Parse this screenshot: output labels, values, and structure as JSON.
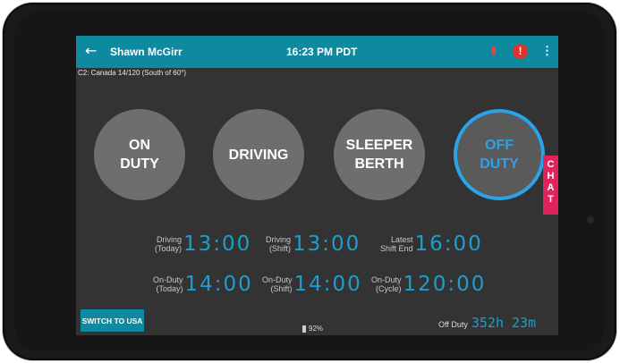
{
  "header": {
    "back_icon": "arrow-left-icon",
    "driver_name": "Shawn McGirr",
    "time": "16:23 PM PDT",
    "alert_glyph": "!",
    "menu_glyph": "⋮"
  },
  "ruleset": "C2: Canada 14/120 (South of 60°)",
  "statuses": [
    {
      "label": "ON\nDUTY",
      "active": false
    },
    {
      "label": "DRIVING",
      "active": false
    },
    {
      "label": "SLEEPER\nBERTH",
      "active": false
    },
    {
      "label": "OFF\nDUTY",
      "active": true
    }
  ],
  "chat_letters": [
    "C",
    "H",
    "A",
    "T"
  ],
  "clocks": {
    "driving_today": {
      "label1": "Driving",
      "label2": "(Today)",
      "value": "13:00"
    },
    "driving_shift": {
      "label1": "Driving",
      "label2": "(Shift)",
      "value": "13:00"
    },
    "latest_shift_end": {
      "label1": "Latest",
      "label2": "Shift End",
      "value": "16:00"
    },
    "onduty_today": {
      "label1": "On-Duty",
      "label2": "(Today)",
      "value": "14:00"
    },
    "onduty_shift": {
      "label1": "On-Duty",
      "label2": "(Shift)",
      "value": "14:00"
    },
    "onduty_cycle": {
      "label1": "On-Duty",
      "label2": "(Cycle)",
      "value": "120:00"
    }
  },
  "switch_button": "SWITCH TO USA",
  "battery": "92%",
  "off_duty": {
    "label": "Off Duty",
    "value": "352h 23m"
  },
  "colors": {
    "accent": "#0d8aa0",
    "clock_blue": "#1c9ed0",
    "chat": "#e2225f",
    "alert": "#e0332d"
  }
}
